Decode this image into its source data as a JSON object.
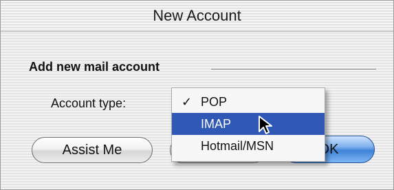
{
  "window": {
    "title": "New Account"
  },
  "section": {
    "label": "Add new mail account"
  },
  "form": {
    "account_type_label": "Account type:"
  },
  "menu": {
    "items": [
      {
        "label": "POP",
        "checked": true,
        "highlighted": false
      },
      {
        "label": "IMAP",
        "checked": false,
        "highlighted": true
      },
      {
        "label": "Hotmail/MSN",
        "checked": false,
        "highlighted": false
      }
    ],
    "check_glyph": "✓"
  },
  "buttons": {
    "assist_label": "Assist Me",
    "ok_label_visible": "OK"
  },
  "colors": {
    "highlight": "#2f58b7",
    "default_button": "#3f82d8"
  }
}
